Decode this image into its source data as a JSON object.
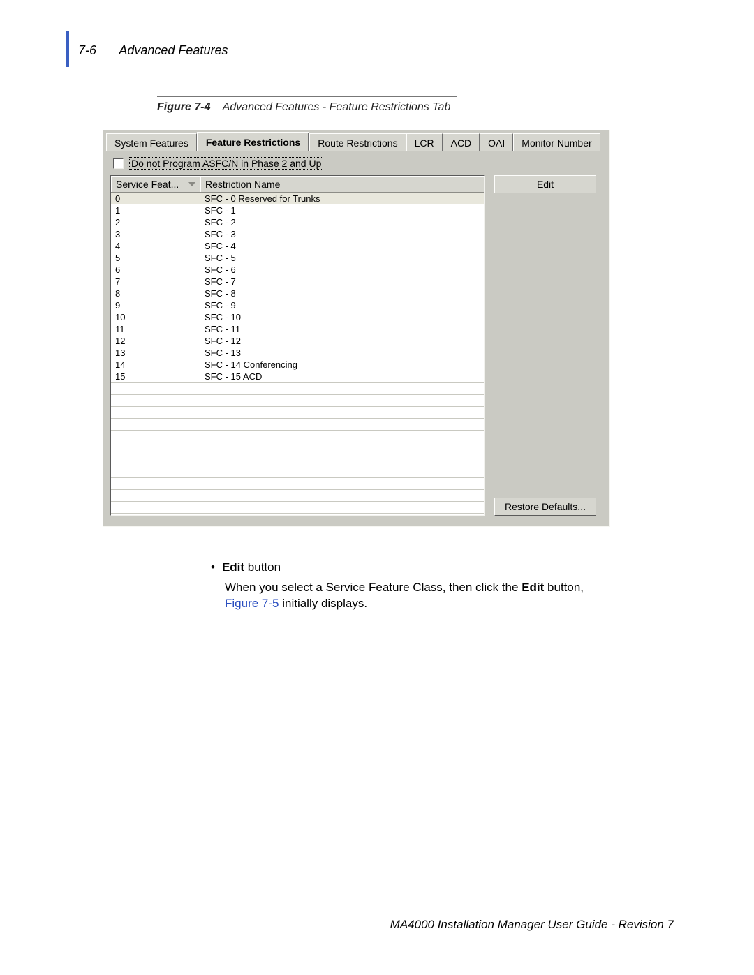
{
  "header": {
    "pageno": "7-6",
    "section": "Advanced Features"
  },
  "figure_caption": {
    "label": "Figure 7-4",
    "text": "Advanced Features - Feature Restrictions Tab"
  },
  "tabs": {
    "items": [
      {
        "label": "System Features"
      },
      {
        "label": "Feature Restrictions"
      },
      {
        "label": "Route Restrictions"
      },
      {
        "label": "LCR"
      },
      {
        "label": "ACD"
      },
      {
        "label": "OAI"
      },
      {
        "label": "Monitor Number"
      }
    ],
    "active_index": 1
  },
  "checkbox": {
    "label": "Do not Program ASFC/N in Phase 2 and Up",
    "checked": false
  },
  "list": {
    "col0_header": "Service Feat...",
    "col1_header": "Restriction Name",
    "selected_index": 0,
    "rows": [
      {
        "sfc": "0",
        "name": "SFC - 0   Reserved for Trunks"
      },
      {
        "sfc": "1",
        "name": "SFC - 1"
      },
      {
        "sfc": "2",
        "name": "SFC - 2"
      },
      {
        "sfc": "3",
        "name": "SFC - 3"
      },
      {
        "sfc": "4",
        "name": "SFC - 4"
      },
      {
        "sfc": "5",
        "name": "SFC - 5"
      },
      {
        "sfc": "6",
        "name": "SFC - 6"
      },
      {
        "sfc": "7",
        "name": "SFC - 7"
      },
      {
        "sfc": "8",
        "name": "SFC - 8"
      },
      {
        "sfc": "9",
        "name": "SFC - 9"
      },
      {
        "sfc": "10",
        "name": "SFC - 10"
      },
      {
        "sfc": "11",
        "name": "SFC - 11"
      },
      {
        "sfc": "12",
        "name": "SFC - 12"
      },
      {
        "sfc": "13",
        "name": "SFC - 13"
      },
      {
        "sfc": "14",
        "name": "SFC - 14   Conferencing"
      },
      {
        "sfc": "15",
        "name": "SFC - 15   ACD"
      }
    ],
    "empty_row_count": 11
  },
  "buttons": {
    "edit": "Edit",
    "restore": "Restore Defaults..."
  },
  "body": {
    "bullet_bold": "Edit",
    "bullet_rest": " button",
    "para_pre": "When you select a Service Feature Class, then click the ",
    "para_bold": "Edit",
    "para_mid": " button, ",
    "figref": "Figure 7-5",
    "para_post": " initially displays."
  },
  "footer": "MA4000 Installation Manager User Guide - Revision 7"
}
